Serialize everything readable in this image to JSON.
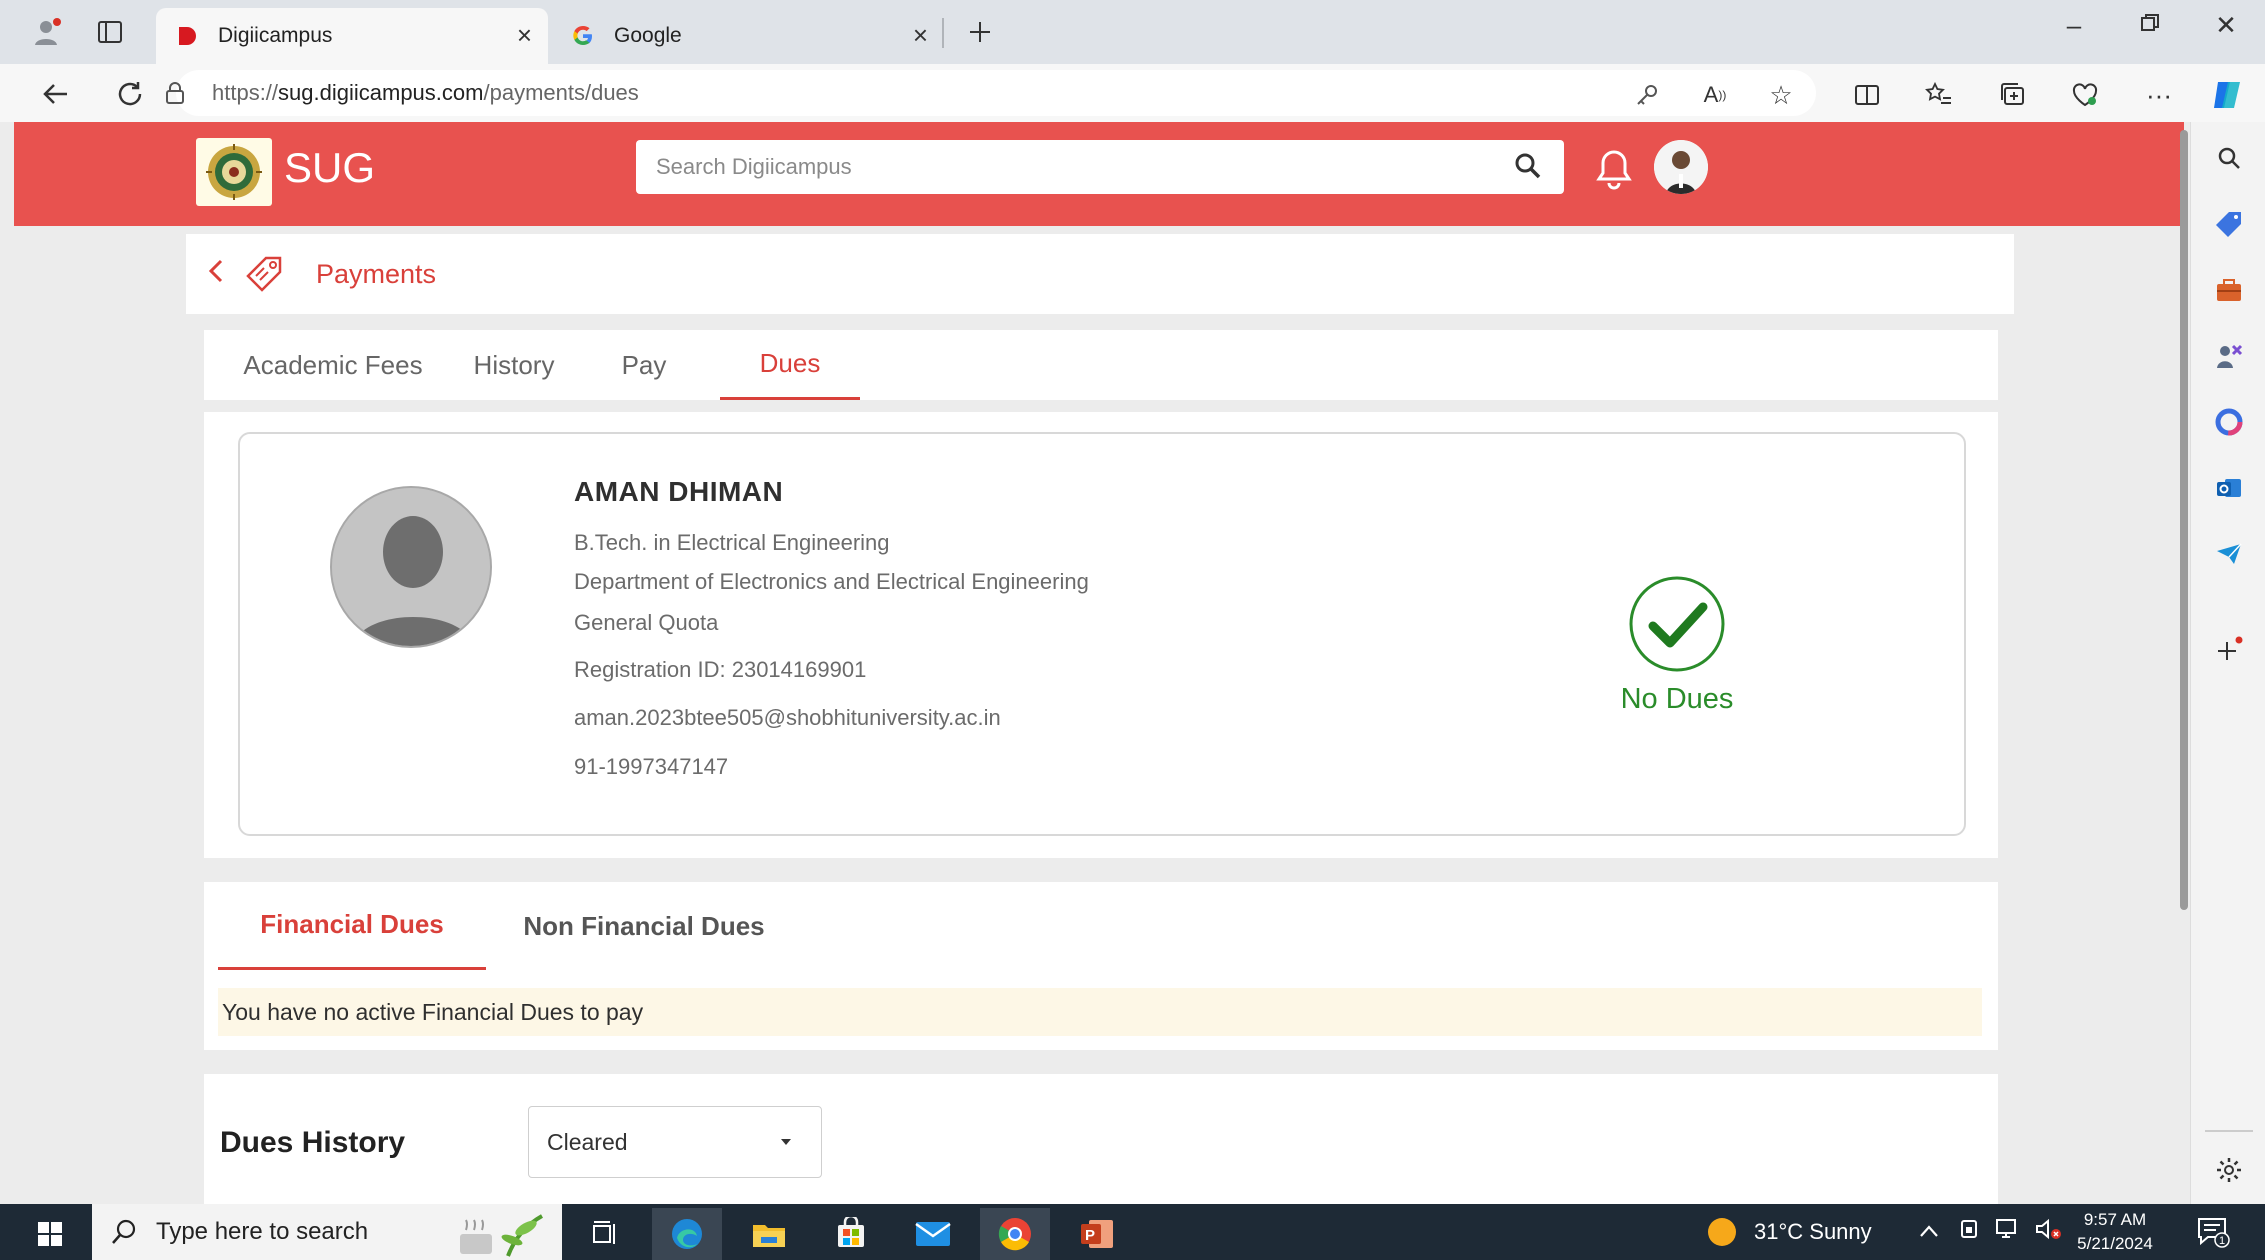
{
  "browser": {
    "tabs": [
      {
        "title": "Digiicampus",
        "active": true
      },
      {
        "title": "Google",
        "active": false
      }
    ],
    "url_prefix": "https://",
    "url_domain": "sug.digiicampus.com",
    "url_path": "/payments/dues"
  },
  "header": {
    "app_name": "SUG",
    "search_placeholder": "Search Digiicampus"
  },
  "breadcrumb": {
    "title": "Payments"
  },
  "tabs": [
    "Academic Fees",
    "History",
    "Pay",
    "Dues"
  ],
  "profile": {
    "name": "AMAN DHIMAN",
    "program": "B.Tech. in Electrical Engineering",
    "department": "Department of Electronics and Electrical Engineering",
    "quota": "General  Quota",
    "registration": "Registration ID: 23014169901",
    "email": "aman.2023btee505@shobhituniversity.ac.in",
    "phone": "91-1997347147",
    "status": "No Dues"
  },
  "dues": {
    "tabs": [
      "Financial Dues",
      "Non Financial Dues"
    ],
    "message": "You have no active Financial Dues to pay"
  },
  "history": {
    "title": "Dues History",
    "selected": "Cleared"
  },
  "taskbar": {
    "search_placeholder": "Type here to search",
    "weather": "31°C  Sunny",
    "time": "9:57 AM",
    "date": "5/21/2024"
  },
  "colors": {
    "brand": "#e8524f",
    "accent": "#d9403a",
    "success": "#2a8c2a"
  }
}
